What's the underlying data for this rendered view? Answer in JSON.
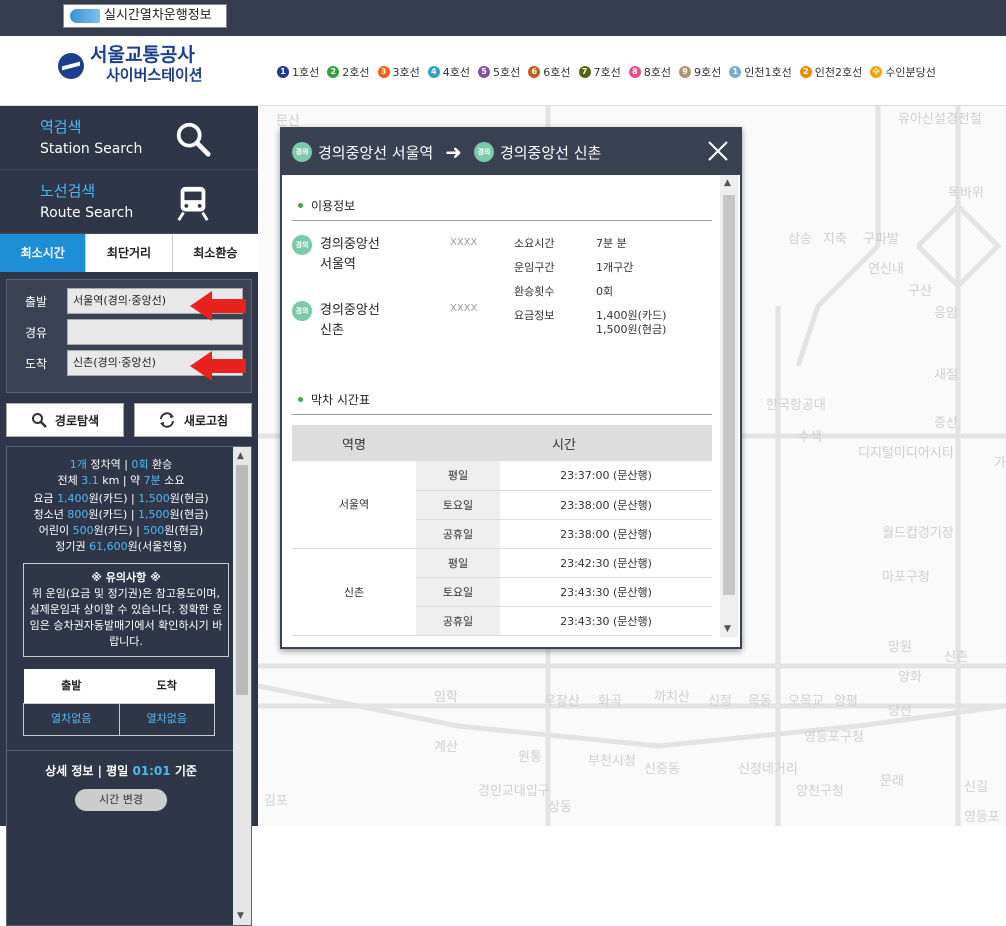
{
  "topbar": {
    "realtime_button": "실시간열차운행정보"
  },
  "logo": {
    "line1": "서울교통공사",
    "line2": "사이버스테이션"
  },
  "subway_lines": [
    {
      "label": "1호선",
      "badge": "1",
      "color": "#1d3a8f"
    },
    {
      "label": "2호선",
      "badge": "2",
      "color": "#33a23d"
    },
    {
      "label": "3호선",
      "badge": "3",
      "color": "#fe5b10"
    },
    {
      "label": "4호선",
      "badge": "4",
      "color": "#32a1c8"
    },
    {
      "label": "5호선",
      "badge": "5",
      "color": "#8b50a4"
    },
    {
      "label": "6호선",
      "badge": "6",
      "color": "#c55c1d"
    },
    {
      "label": "7호선",
      "badge": "7",
      "color": "#54640d"
    },
    {
      "label": "8호선",
      "badge": "8",
      "color": "#f14c82"
    },
    {
      "label": "9호선",
      "badge": "9",
      "color": "#aa9872"
    },
    {
      "label": "인천1호선",
      "badge": "1",
      "color": "#7ca8d5"
    },
    {
      "label": "인천2호선",
      "badge": "2",
      "color": "#ed8b00"
    },
    {
      "label": "수인분당선",
      "badge": "수",
      "color": "#f5a200"
    }
  ],
  "sidebar": {
    "station_search": {
      "ko": "역검색",
      "en": "Station Search"
    },
    "route_search": {
      "ko": "노선검색",
      "en": "Route Search"
    },
    "tabs": [
      "최소시간",
      "최단거리",
      "최소환승"
    ],
    "form": {
      "depart_label": "출발",
      "depart_value": "서울역(경의·중앙선)",
      "via_label": "경유",
      "via_value": "",
      "arrive_label": "도착",
      "arrive_value": "신촌(경의·중앙선)"
    },
    "route_button": "경로탐색",
    "refresh_button": "새로고침",
    "summary": {
      "stops": "1개",
      "stops_label": " 정차역 | ",
      "transfers": "0회",
      "transfers_label": " 환승",
      "distance_prefix": "전체 ",
      "distance": "3.1",
      "distance_unit": " km | 약 ",
      "duration": "7분",
      "duration_suffix": " 소요",
      "fare_prefix": "요금 ",
      "fare_card": "1,400",
      "fare_card_suffix": "원(카드) | ",
      "fare_cash": "1,500",
      "fare_cash_suffix": "원(현금)",
      "youth_prefix": "청소년 ",
      "youth_card": "800",
      "youth_card_suffix": "원(카드) | ",
      "youth_cash": "1,500",
      "youth_cash_suffix": "원(현금)",
      "child_prefix": "어린이 ",
      "child_card": "500",
      "child_card_suffix": "원(카드) | ",
      "child_cash": "500",
      "child_cash_suffix": "원(현금)",
      "pass_prefix": "정기권 ",
      "pass_value": "61,600",
      "pass_suffix": "원(서울전용)",
      "notice_title": "※ 유의사항 ※",
      "notice_text": "위 운임(요금 및 정기권)은 참고용도이며, 실제운임과 상이할 수 있습니다. 정확한 운임은 승차권자동발매기에서 확인하시기 바랍니다.",
      "dep_header": "출발",
      "arr_header": "도착",
      "dep_value": "열차없음",
      "arr_value": "열차없음",
      "detail_prefix": "상세 정보 | 평일 ",
      "detail_time": "01:01",
      "detail_suffix": " 기준",
      "time_change": "시간 변경"
    }
  },
  "popup": {
    "from": "경의중앙선 서울역",
    "to": "경의중앙선 신촌",
    "badge": "경의",
    "section_info": "이용정보",
    "station1_line1": "경의중앙선",
    "station1_line2": "서울역",
    "station2_line1": "경의중앙선",
    "station2_line2": "신촌",
    "xx1": "XXXX",
    "xx2": "XXXX",
    "duration_label": "소요시간",
    "duration_value": "7분 분",
    "section_label": "운임구간",
    "section_value": "1개구간",
    "transfer_label": "환승횟수",
    "transfer_value": "0회",
    "fare_label": "요금정보",
    "fare_value1": "1,400원(카드)",
    "fare_value2": "1,500원(현금)",
    "section_timetable": "막차 시간표",
    "tt_header_station": "역명",
    "tt_header_time": "시간",
    "timetable": [
      {
        "station": "서울역",
        "rows": [
          {
            "day": "평일",
            "time": "23:37:00 (문산행)"
          },
          {
            "day": "토요일",
            "time": "23:38:00 (문산행)"
          },
          {
            "day": "공휴일",
            "time": "23:38:00 (문산행)"
          }
        ]
      },
      {
        "station": "신촌",
        "rows": [
          {
            "day": "평일",
            "time": "23:42:30 (문산행)"
          },
          {
            "day": "토요일",
            "time": "23:43:30 (문산행)"
          },
          {
            "day": "공휴일",
            "time": "23:43:30 (문산행)"
          }
        ]
      }
    ]
  },
  "map": {
    "labels": [
      "문산",
      "목바위",
      "유아신설경전철",
      "삼송",
      "지축",
      "구파발",
      "연신내",
      "구산",
      "응암",
      "새절",
      "증산",
      "한국항공대",
      "수색",
      "디지털미디어시티",
      "가좌",
      "월드컵경기장",
      "마포구청",
      "망원",
      "신촌",
      "양화",
      "당산",
      "우장산",
      "화곡",
      "까치산",
      "신정",
      "목동",
      "오목교",
      "양평",
      "영등포구청",
      "부천시청",
      "신중동",
      "신정네거리",
      "양천구청",
      "문래",
      "신길",
      "김포",
      "계산",
      "임학",
      "원통",
      "상동",
      "경인교대입구",
      "영등포"
    ]
  }
}
